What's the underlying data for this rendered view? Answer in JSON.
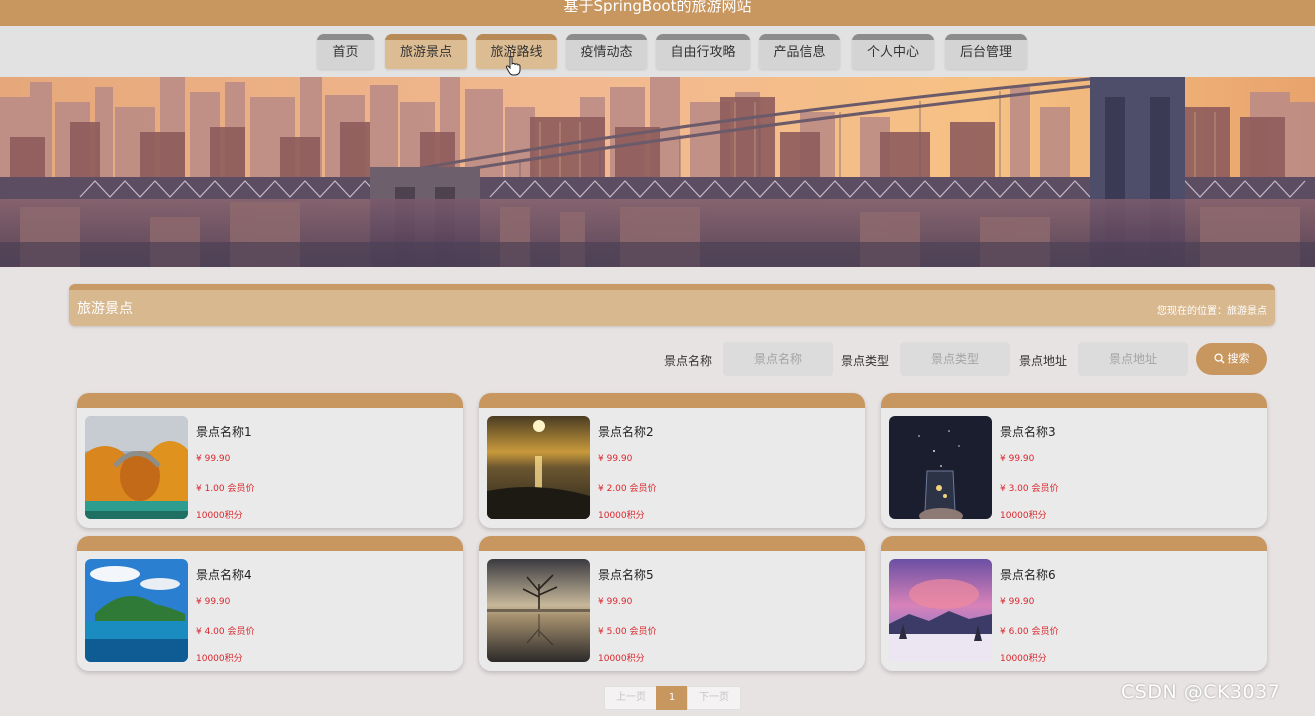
{
  "header": {
    "title": "基于SpringBoot的旅游网站"
  },
  "nav": {
    "items": [
      {
        "label": "首页"
      },
      {
        "label": "旅游景点"
      },
      {
        "label": "旅游路线"
      },
      {
        "label": "疫情动态"
      },
      {
        "label": "自由行攻略"
      },
      {
        "label": "产品信息"
      },
      {
        "label": "个人中心"
      },
      {
        "label": "后台管理"
      }
    ],
    "active": "旅游景点"
  },
  "section": {
    "title": "旅游景点",
    "breadcrumb": "您现在的位置：旅游景点"
  },
  "search": {
    "name_label": "景点名称",
    "name_placeholder": "景点名称",
    "type_label": "景点类型",
    "type_placeholder": "景点类型",
    "address_label": "景点地址",
    "address_placeholder": "景点地址",
    "button_label": "搜索"
  },
  "cards": [
    {
      "name": "景点名称1",
      "price": "¥ 99.90",
      "member_price": "¥ 1.00 会员价",
      "points": "10000积分"
    },
    {
      "name": "景点名称2",
      "price": "¥ 99.90",
      "member_price": "¥ 2.00 会员价",
      "points": "10000积分"
    },
    {
      "name": "景点名称3",
      "price": "¥ 99.90",
      "member_price": "¥ 3.00 会员价",
      "points": "10000积分"
    },
    {
      "name": "景点名称4",
      "price": "¥ 99.90",
      "member_price": "¥ 4.00 会员价",
      "points": "10000积分"
    },
    {
      "name": "景点名称5",
      "price": "¥ 99.90",
      "member_price": "¥ 5.00 会员价",
      "points": "10000积分"
    },
    {
      "name": "景点名称6",
      "price": "¥ 99.90",
      "member_price": "¥ 6.00 会员价",
      "points": "10000积分"
    }
  ],
  "pagination": {
    "prev_label": "上一页",
    "current_page": "1",
    "next_label": "下一页"
  },
  "watermark": "CSDN @CK3037",
  "colors": {
    "brand": "#c8965f",
    "price_red": "#d9282e",
    "page_bg": "#e8e3e3"
  }
}
